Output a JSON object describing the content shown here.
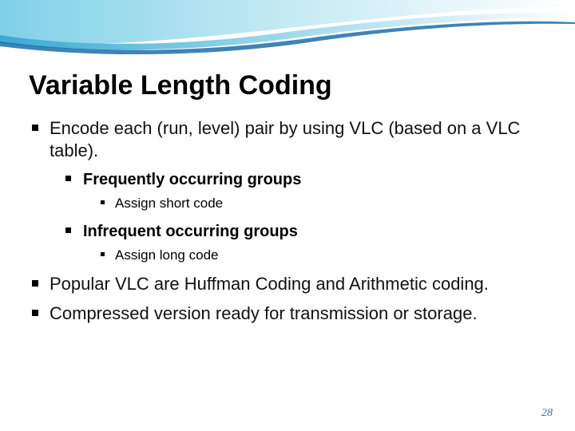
{
  "title": "Variable Length Coding",
  "bullets": {
    "b1": "Encode each (run, level) pair by using VLC (based on a VLC table).",
    "b1_1": "Frequently occurring groups",
    "b1_1_1": "Assign short code",
    "b1_2": "Infrequent occurring groups",
    "b1_2_1": "Assign long code",
    "b2": "Popular VLC are Huffman Coding and Arithmetic coding.",
    "b3": "Compressed version ready for transmission or storage."
  },
  "page_number": "28"
}
